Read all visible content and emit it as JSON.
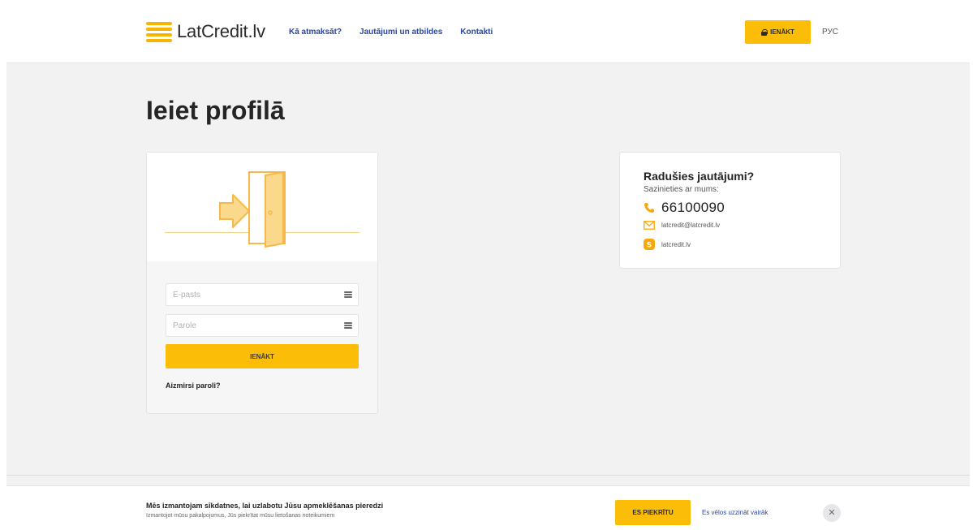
{
  "header": {
    "logo_text": "LatCredit.lv",
    "nav": [
      "Kā atmaksāt?",
      "Jautājumi un atbildes",
      "Kontakti"
    ],
    "login_label": "IENĀKT",
    "lang_label": "РУС"
  },
  "page": {
    "title": "Ieiet profilā"
  },
  "login_form": {
    "email_placeholder": "E-pasts",
    "password_placeholder": "Parole",
    "submit_label": "IENĀKT",
    "forgot_label": "Aizmirsi paroli?"
  },
  "contact": {
    "title": "Radušies jautājumi?",
    "subtitle": "Sazinieties ar mums:",
    "phone": "66100090",
    "email": "latcredit@latcredit.lv",
    "skype": "latcredit.lv"
  },
  "cookie": {
    "title": "Mēs izmantojam sīkdatnes, lai uzlabotu Jūsu apmeklēšanas pieredzi",
    "text": "Izmantojot mūsu pakalpojumus, Jūs piekrītat mūsu lietošanas noteikumiem",
    "agree_label": "ES PIEKRĪTU",
    "more_label": "Es vēlos uzzināt vairāk",
    "close_label": "✕"
  },
  "colors": {
    "accent": "#fbbd08",
    "link": "#2547a8",
    "background": "#f2f2f3"
  },
  "icons": [
    "logo-stack-icon",
    "lock-icon",
    "door-arrow-icon",
    "list-icon",
    "phone-icon",
    "mail-icon",
    "skype-icon",
    "close-icon"
  ]
}
